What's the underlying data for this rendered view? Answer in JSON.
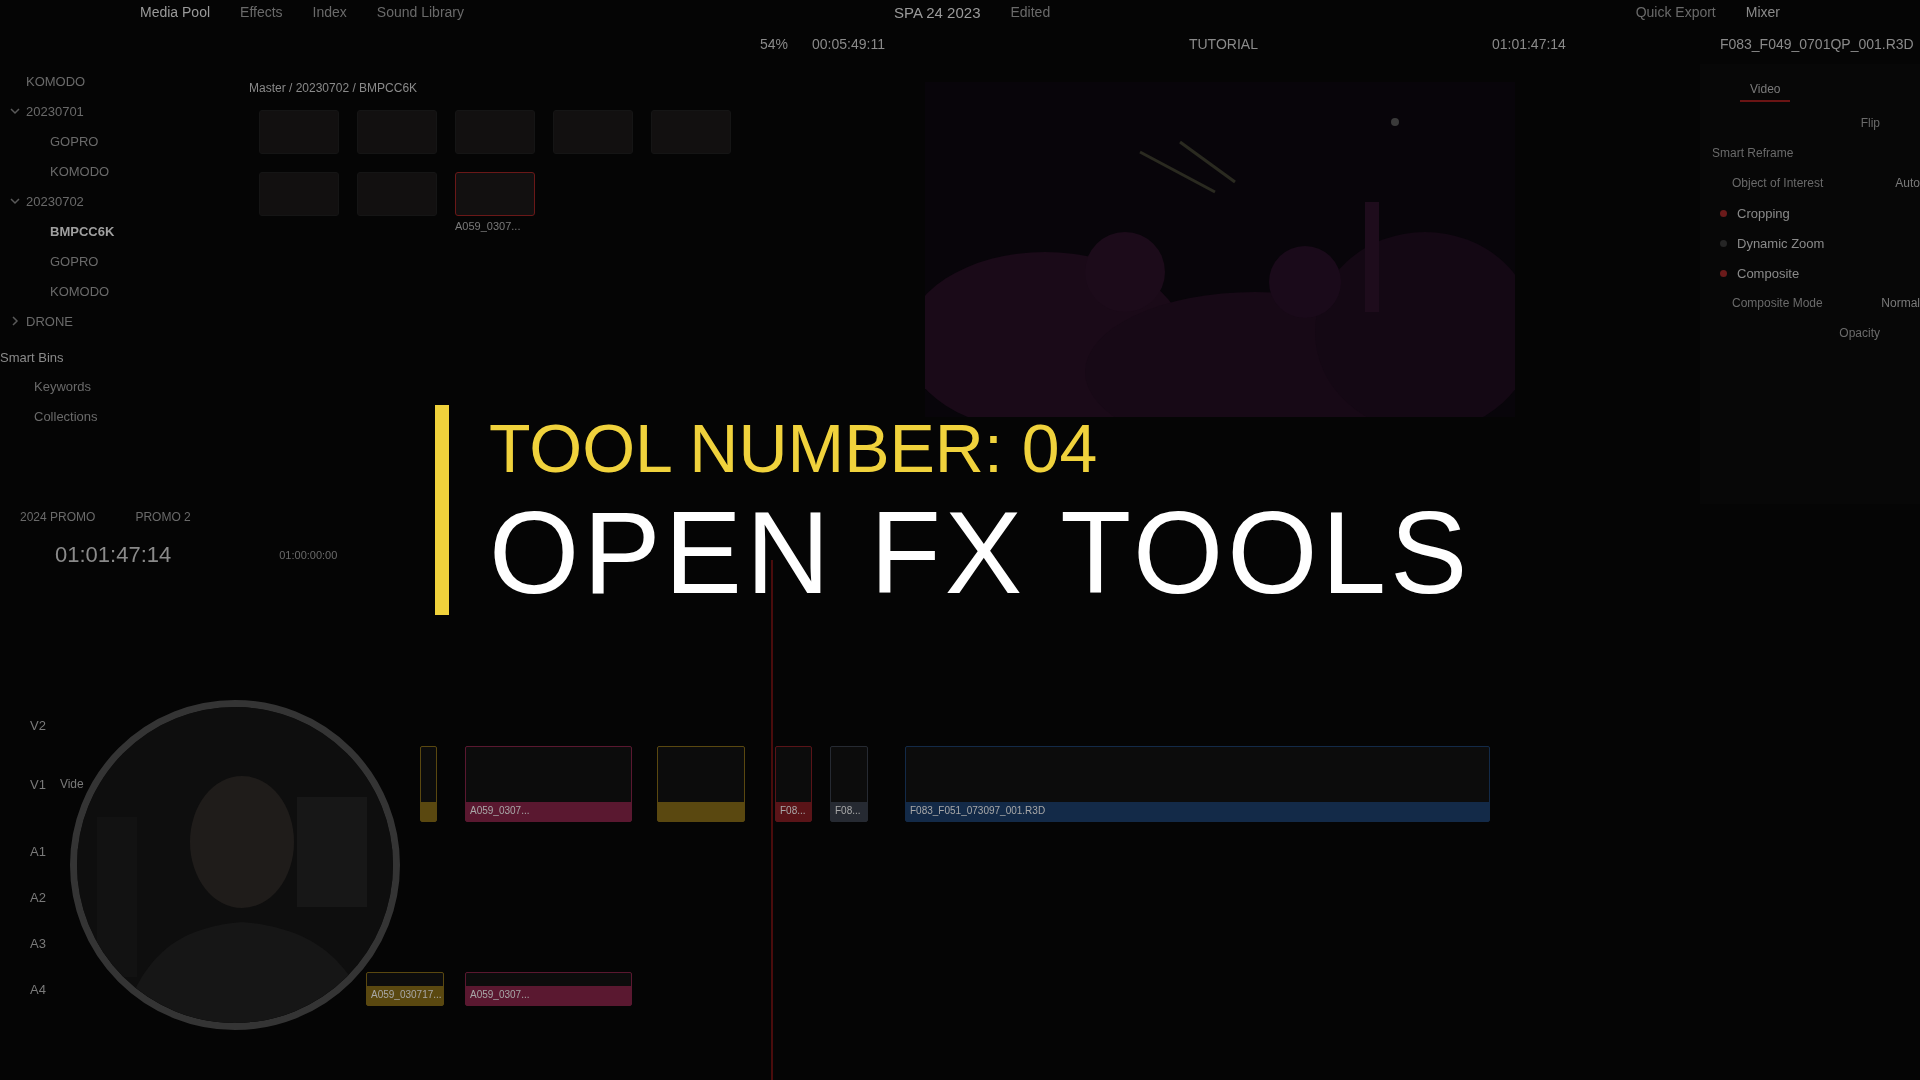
{
  "menu_bar": {
    "left": [
      "Media Pool",
      "Effects",
      "Index",
      "Sound Library"
    ],
    "project": "SPA 24 2023",
    "status": "Edited",
    "right": [
      "Quick Export",
      "Mixer"
    ]
  },
  "toolbar": {
    "zoom": "54%",
    "duration": "00:05:49:11",
    "timeline": "TUTORIAL",
    "timecode": "01:01:47:14",
    "clip_name": "F083_F049_0701QP_001.R3D"
  },
  "bins": [
    {
      "label": "KOMODO",
      "selected": false
    },
    {
      "label": "20230701",
      "selected": false,
      "expanded": true,
      "children": [
        {
          "label": "GOPRO",
          "selected": false
        },
        {
          "label": "KOMODO",
          "selected": false
        }
      ]
    },
    {
      "label": "20230702",
      "selected": false,
      "expanded": true,
      "children": [
        {
          "label": "BMPCC6K",
          "selected": true
        },
        {
          "label": "GOPRO",
          "selected": false
        },
        {
          "label": "KOMODO",
          "selected": false
        }
      ]
    },
    {
      "label": "DRONE",
      "selected": false,
      "expanded": false
    }
  ],
  "smart_bins": {
    "title": "Smart Bins",
    "items": [
      "Keywords",
      "Collections"
    ]
  },
  "media_pool": {
    "path": "Master / 20230702 / BMPCC6K",
    "clips": [
      {
        "selected": false
      },
      {
        "selected": false
      },
      {
        "selected": false
      },
      {
        "selected": false
      },
      {
        "selected": false
      },
      {
        "selected": false
      },
      {
        "selected": false
      },
      {
        "name": "A059_0307...",
        "selected": true
      }
    ]
  },
  "inspector": {
    "tabs": [
      {
        "label": "Video",
        "selected": true
      }
    ],
    "rows": [
      {
        "kind": "label",
        "label": "Flip"
      },
      {
        "kind": "section",
        "label": "Smart Reframe"
      },
      {
        "kind": "field",
        "label": "Object of Interest",
        "value": "Auto"
      },
      {
        "kind": "group",
        "label": "Cropping",
        "enabled": true
      },
      {
        "kind": "group",
        "label": "Dynamic Zoom",
        "enabled": false
      },
      {
        "kind": "group",
        "label": "Composite",
        "enabled": true
      },
      {
        "kind": "field",
        "label": "Composite Mode",
        "value": "Normal"
      },
      {
        "kind": "label",
        "label": "Opacity"
      }
    ]
  },
  "timeline": {
    "tabs": [
      "2024 PROMO",
      "PROMO 2"
    ],
    "timecode": "01:01:47:14",
    "ruler": [
      "01:00:00:00"
    ],
    "tracks": [
      {
        "label": "V2",
        "kind": "video"
      },
      {
        "label": "V1",
        "kind": "video",
        "name": "Vide",
        "clips": [
          {
            "color": "#5a4810"
          },
          {
            "name": "A059_0307...",
            "color": "#5a1830"
          },
          {
            "color": "#5a4810"
          },
          {
            "name": "F08...",
            "color": "#5a1418"
          },
          {
            "name": "F08...",
            "color": "#262a32"
          },
          {
            "name": "F083_F051_073097_001.R3D",
            "color": "#132a48"
          }
        ]
      },
      {
        "label": "A1",
        "kind": "audio"
      },
      {
        "label": "A2",
        "kind": "audio"
      },
      {
        "label": "A3",
        "kind": "audio"
      },
      {
        "label": "A4",
        "kind": "audio",
        "clips": [
          {
            "name": "A059_030717...",
            "color": "#5a4810"
          },
          {
            "name": "A059_0307...",
            "color": "#5a1830"
          }
        ]
      }
    ]
  },
  "overlay": {
    "kicker": "TOOL NUMBER: 04",
    "title": "OPEN FX TOOLS"
  }
}
